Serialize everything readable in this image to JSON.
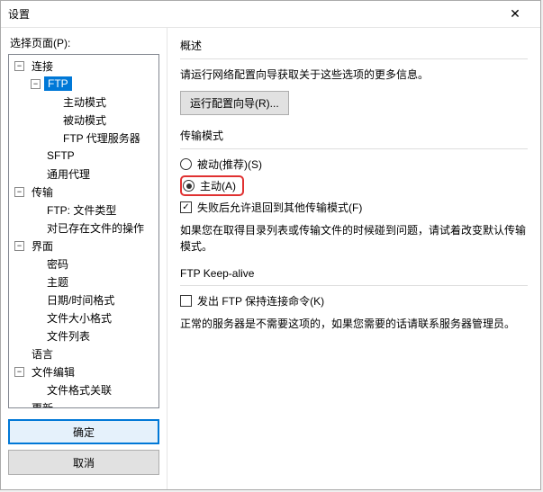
{
  "titlebar": {
    "title": "设置",
    "close": "✕"
  },
  "leftPane": {
    "selectLabel": "选择页面(P):",
    "tree": {
      "connection": {
        "label": "连接",
        "ftp": "FTP",
        "activeMode": "主动模式",
        "passiveMode": "被动模式",
        "ftpProxy": "FTP 代理服务器",
        "sftp": "SFTP",
        "genericProxy": "通用代理"
      },
      "transfer": {
        "label": "传输",
        "ftpFileTypes": "FTP: 文件类型",
        "fileExists": "对已存在文件的操作"
      },
      "interface": {
        "label": "界面",
        "password": "密码",
        "theme": "主题",
        "dateTime": "日期/时间格式",
        "filesize": "文件大小格式",
        "filelist": "文件列表"
      },
      "language": "语言",
      "fileEdit": {
        "label": "文件编辑",
        "assoc": "文件格式关联"
      },
      "update": "更新"
    },
    "buttons": {
      "ok": "确定",
      "cancel": "取消"
    }
  },
  "rightPane": {
    "overview": {
      "title": "概述",
      "desc": "请运行网络配置向导获取关于这些选项的更多信息。",
      "wizardBtn": "运行配置向导(R)..."
    },
    "transferMode": {
      "title": "传输模式",
      "passive": "被动(推荐)(S)",
      "active": "主动(A)",
      "fallback": "失败后允许退回到其他传输模式(F)",
      "note": "如果您在取得目录列表或传输文件的时候碰到问题，请试着改变默认传输模式。"
    },
    "keepalive": {
      "title": "FTP Keep-alive",
      "sendCmd": "发出 FTP 保持连接命令(K)",
      "note": "正常的服务器是不需要这项的，如果您需要的话请联系服务器管理员。"
    }
  }
}
